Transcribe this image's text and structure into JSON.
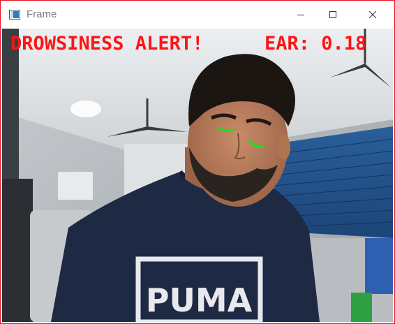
{
  "window": {
    "title": "Frame",
    "border_color": "#e81123",
    "icons": {
      "app": "frame-window-icon",
      "minimize": "minimize-icon",
      "maximize": "maximize-icon",
      "close": "close-icon"
    }
  },
  "video": {
    "alert_text": "DROWSINESS ALERT!",
    "ear_label": "EAR:",
    "ear_value": "0.18",
    "overlay_color": "#ff1414",
    "eye_contour_color": "#1ee01e",
    "shirt_brand": "PUMA"
  }
}
